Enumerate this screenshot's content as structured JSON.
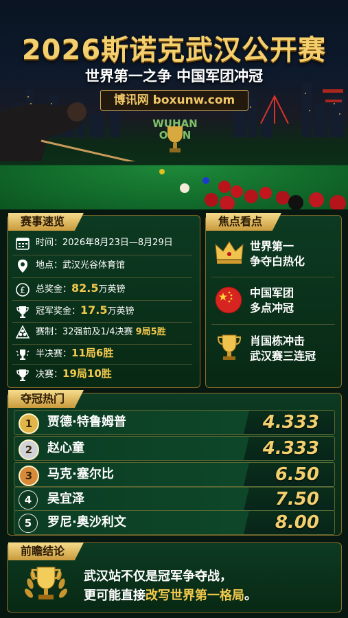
{
  "header": {
    "title": "2026斯诺克武汉公开赛",
    "subtitle": "世界第一之争 中国军团冲冠",
    "source_badge": "博讯网 boxunw.com",
    "venue_sign": "WUHAN OPEN"
  },
  "overview": {
    "tag": "赛事速览",
    "rows": [
      {
        "icon": "calendar-icon",
        "label": "时间：",
        "value": "2026年8月23日—8月29日"
      },
      {
        "icon": "location-pin-icon",
        "label": "地点：",
        "value": "武汉光谷体育馆"
      },
      {
        "icon": "pound-coin-icon",
        "label": "总奖金：",
        "highlight": "82.5",
        "suffix": "万英镑"
      },
      {
        "icon": "trophy-icon",
        "label": "冠军奖金：",
        "highlight": "17.5",
        "suffix": "万英镑"
      },
      {
        "icon": "snooker-balls-icon",
        "label": "赛制：",
        "value": "32强前及1/4决赛 ",
        "highlight": "9局5胜"
      },
      {
        "icon": "semifinal-icon",
        "label": "半决赛：",
        "highlight": "11局6胜"
      },
      {
        "icon": "final-trophy-icon",
        "label": "决赛：",
        "highlight": "19局10胜"
      }
    ]
  },
  "focus": {
    "tag": "焦点看点",
    "items": [
      {
        "icon": "crown-icon",
        "line1": "世界第一",
        "line2": "争夺白热化"
      },
      {
        "icon": "china-flag-icon",
        "line1": "中国军团",
        "line2": "多点冲冠"
      },
      {
        "icon": "trophy-icon",
        "line1": "肖国栋冲击",
        "line2": "武汉赛三连冠"
      }
    ]
  },
  "favorites": {
    "tag": "夺冠热门",
    "rows": [
      {
        "rank": "1",
        "name": "贾德·特鲁姆普",
        "odds": "4.333",
        "medal": "#e0b54a"
      },
      {
        "rank": "2",
        "name": "赵心童",
        "odds": "4.333",
        "medal": "#cfd3d8"
      },
      {
        "rank": "3",
        "name": "马克·塞尔比",
        "odds": "6.50",
        "medal": "#d68a3a"
      },
      {
        "rank": "4",
        "name": "吴宜泽",
        "odds": "7.50",
        "medal": "#0e3a22"
      },
      {
        "rank": "5",
        "name": "罗尼·奥沙利文",
        "odds": "8.00",
        "medal": "#0e3a22"
      }
    ]
  },
  "conclusion": {
    "tag": "前瞻结论",
    "line1": "武汉站不仅是冠军争夺战，",
    "line2_a": "更可能直接",
    "line2_b": "改写世界第一格局",
    "line2_c": "。"
  },
  "colors": {
    "gold": "#f2c94c",
    "panel_border": "#8d6d2a",
    "felt_green": "#126c2b"
  }
}
